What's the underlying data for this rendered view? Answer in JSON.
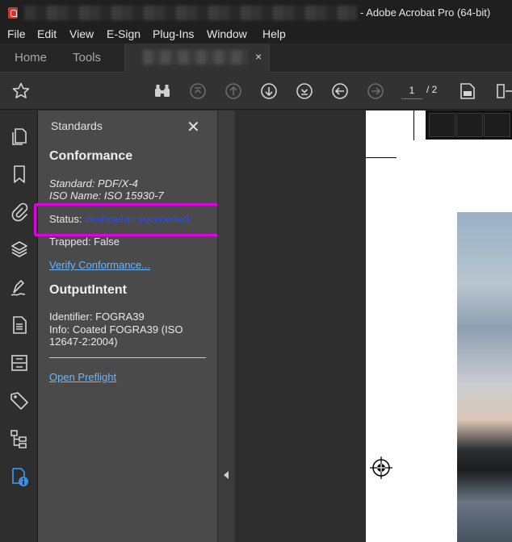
{
  "window": {
    "title": "- Adobe Acrobat Pro (64-bit)"
  },
  "menu": [
    "File",
    "Edit",
    "View",
    "E-Sign",
    "Plug-Ins",
    "Window",
    "Help"
  ],
  "tabs": {
    "home": "Home",
    "tools": "Tools",
    "doc_close": "×"
  },
  "toolbar": {
    "current_page": "1",
    "total_pages": "/ 2"
  },
  "panel": {
    "title": "Standards",
    "close": "✕",
    "conformance": {
      "heading": "Conformance",
      "standard": "Standard: PDF/X-4",
      "iso_name": "ISO Name: ISO 15930-7",
      "status_label": "Status:",
      "status_value": "verification succeeded",
      "trapped": "Trapped: False",
      "verify_link": "Verify Conformance..."
    },
    "output_intent": {
      "heading": "OutputIntent",
      "identifier": "Identifier: FOGRA39",
      "info_line1": "Info: Coated FOGRA39 (ISO",
      "info_line2": "12647-2:2004)"
    },
    "preflight_link": "Open Preflight"
  },
  "annotation": {
    "question_mark": "?",
    "color": "#e100e6"
  },
  "icons": {
    "rail": [
      "copy-pages-icon",
      "bookmark-icon",
      "attachment-icon",
      "layers-icon",
      "signature-icon",
      "document-icon",
      "compare-icon",
      "tag-icon",
      "structure-icon",
      "standards-info-icon"
    ],
    "toolbar": [
      "star-icon",
      "binoculars-icon",
      "first-page-icon",
      "previous-page-icon",
      "next-page-icon",
      "last-page-icon",
      "back-icon",
      "forward-icon",
      "page-thumbnail-icon"
    ]
  }
}
